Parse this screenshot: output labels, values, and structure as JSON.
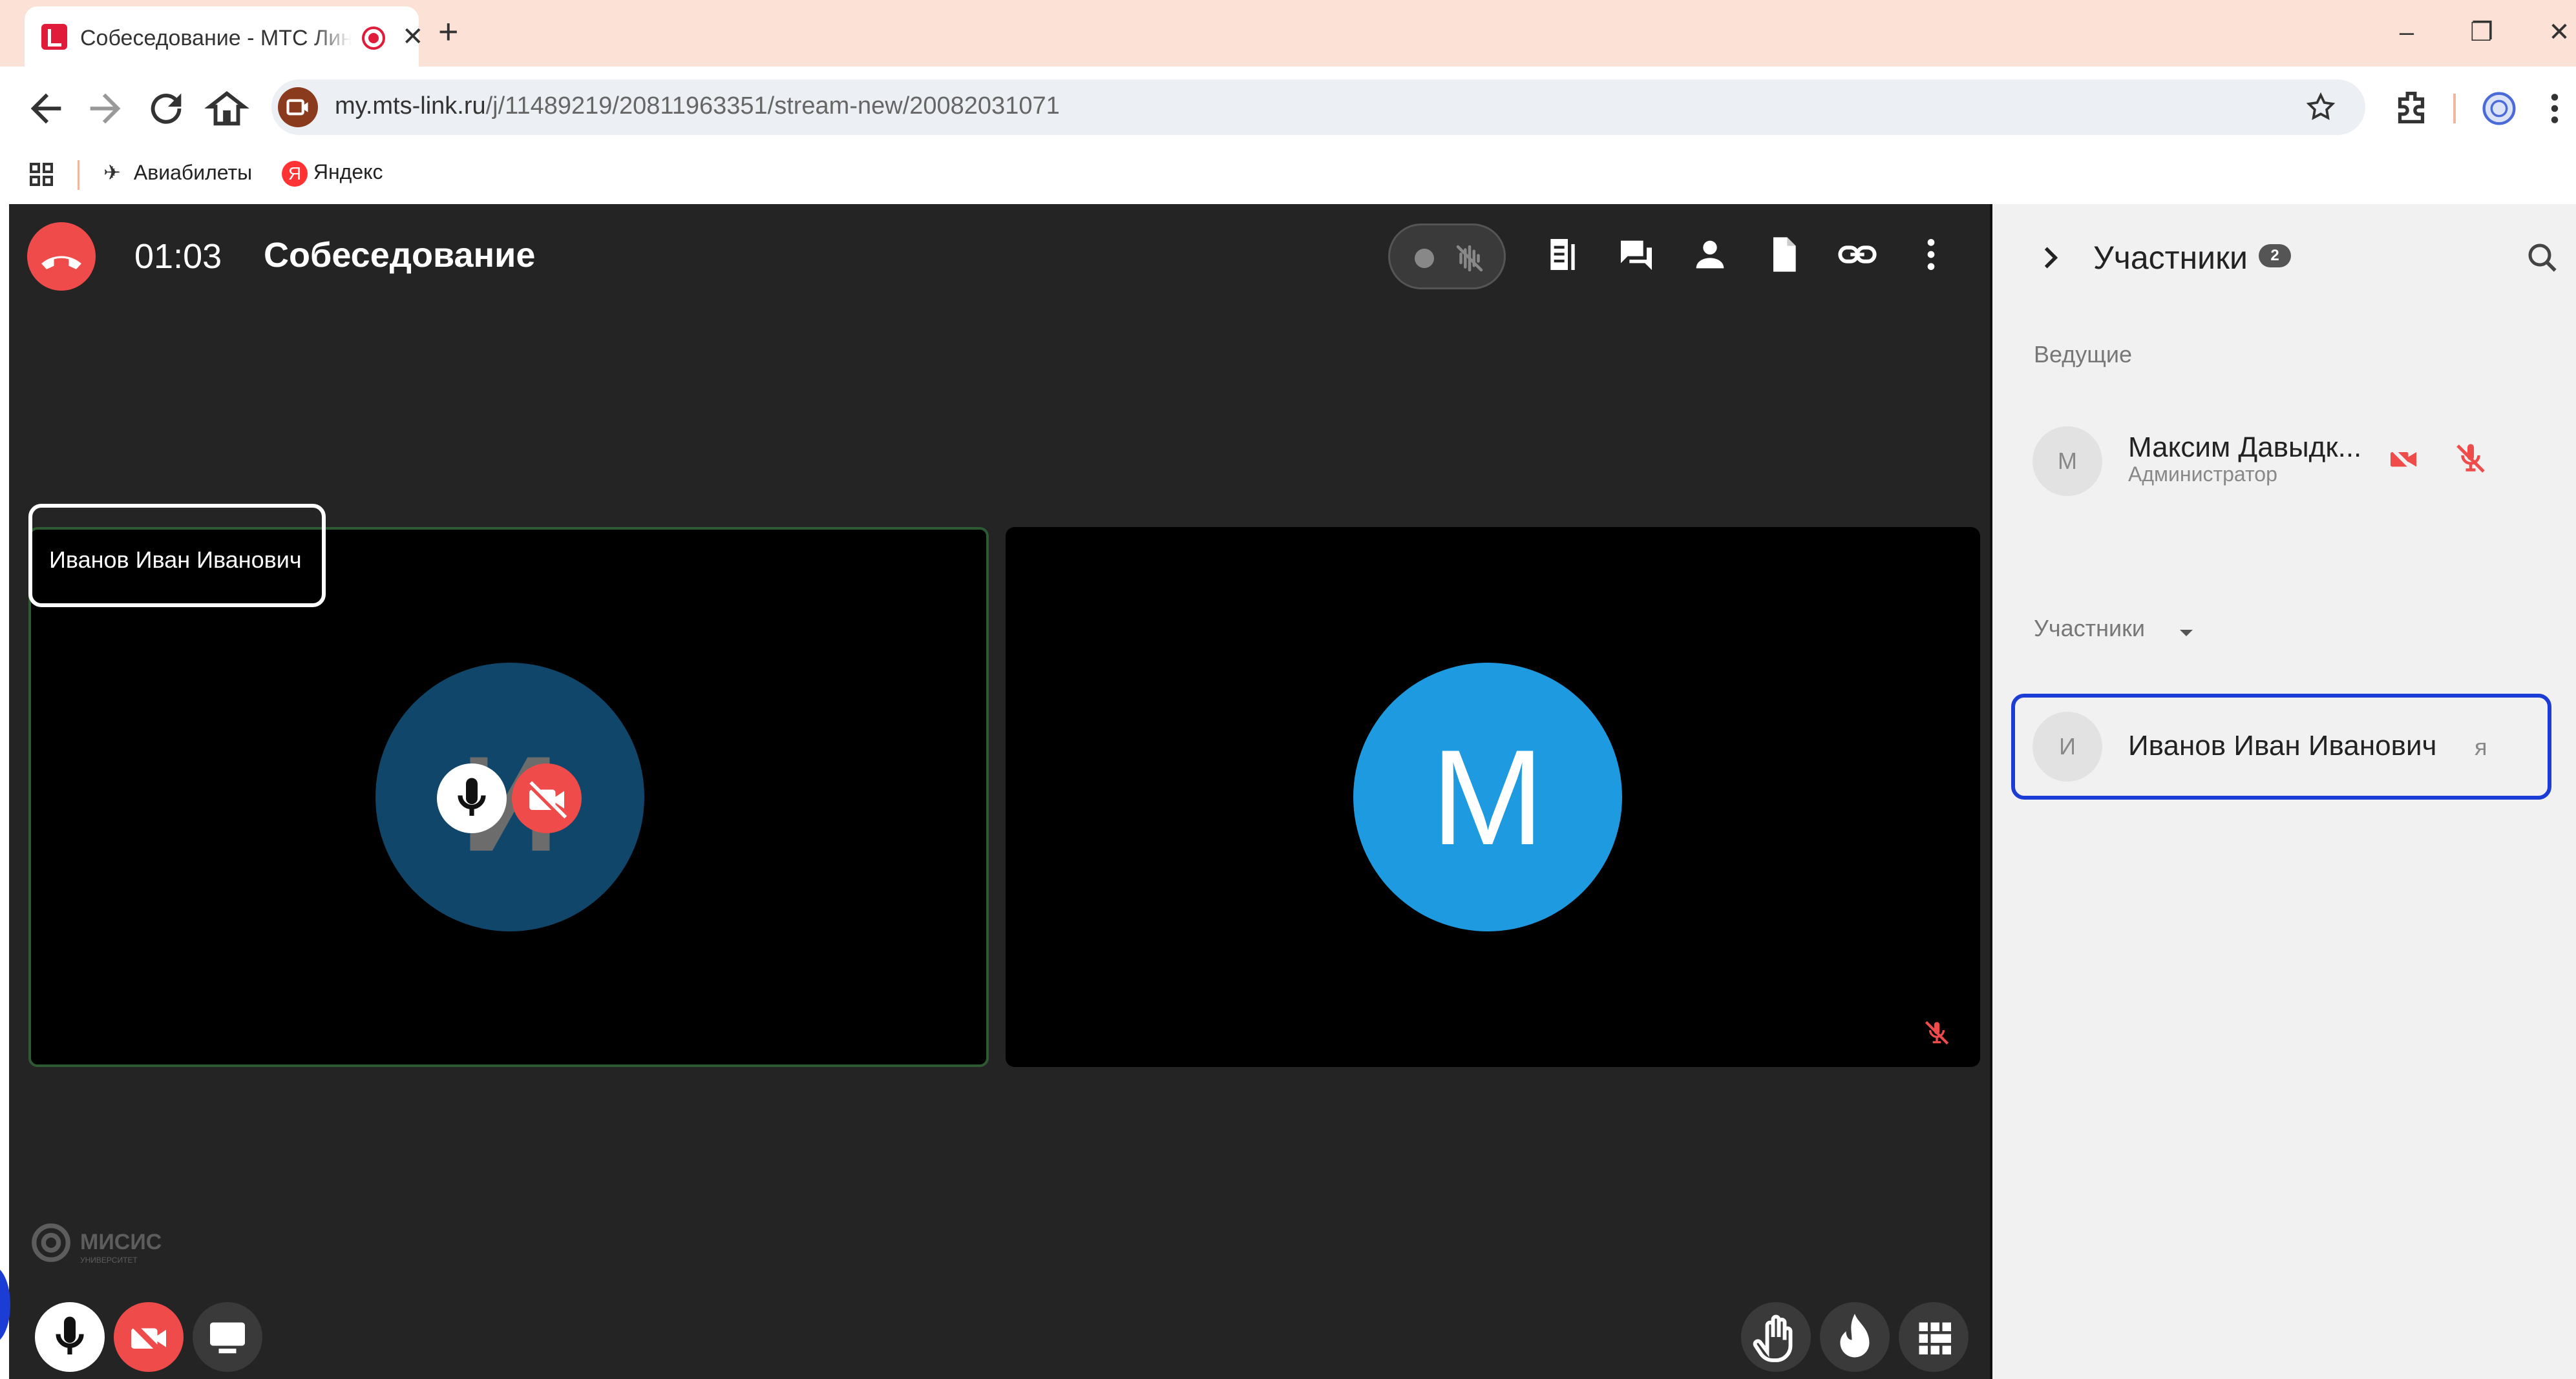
{
  "browser": {
    "tab_title": "Собеседование - МТС Линк",
    "url_host": "my.mts-link.ru",
    "url_path": "/j/11489219/20811963351/stream-new/20082031071",
    "new_tab_label": "+",
    "bookmarks": [
      {
        "label": "Авиабилеты"
      },
      {
        "label": "Яндекс"
      }
    ]
  },
  "meeting": {
    "timer": "01:03",
    "title": "Собеседование",
    "tiles": [
      {
        "name": "Иванов Иван Иванович",
        "avatar_letter": "И",
        "avatar_color": "#10466a",
        "mic": "on",
        "camera": "off"
      },
      {
        "avatar_letter": "М",
        "avatar_color": "#1e9ae0",
        "mic": "muted"
      }
    ],
    "logo": {
      "name": "МИСИС",
      "subtitle": "УНИВЕРСИТЕТ"
    }
  },
  "participants_panel": {
    "title": "Участники",
    "count": "2",
    "hosts_label": "Ведущие",
    "hosts": [
      {
        "initial": "М",
        "name": "Максим Давыдк...",
        "role": "Администратор"
      }
    ],
    "participants_label": "Участники",
    "participants": [
      {
        "initial": "И",
        "name": "Иванов Иван Иванович",
        "me_label": "я"
      }
    ]
  },
  "colors": {
    "accent_red": "#ef4b4b",
    "selection_blue": "#1c3cd6",
    "stage_bg": "#242424",
    "avatar_blue": "#1e9ae0"
  }
}
